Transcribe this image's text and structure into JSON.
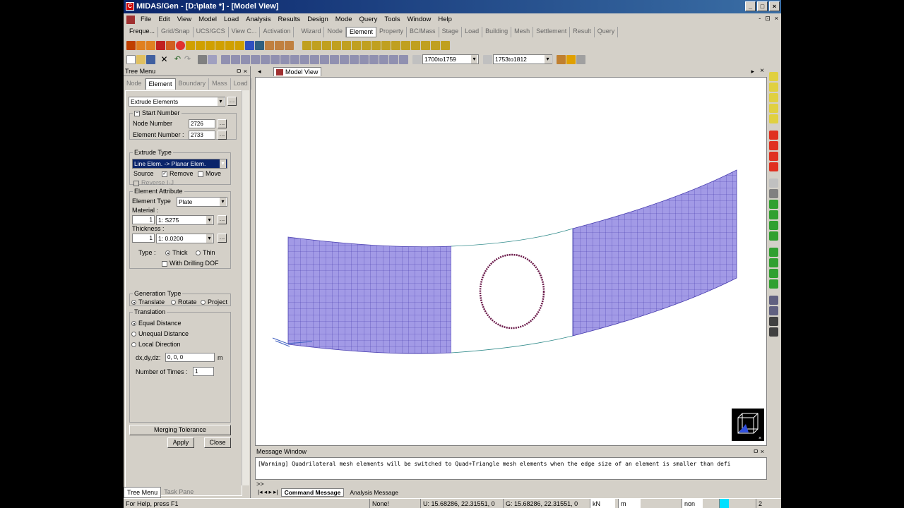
{
  "window": {
    "title": "MIDAS/Gen - [D:\\plate *] - [Model View]",
    "buttons": [
      "_",
      "□",
      "×"
    ]
  },
  "menu": {
    "items": [
      "File",
      "Edit",
      "View",
      "Model",
      "Load",
      "Analysis",
      "Results",
      "Design",
      "Mode",
      "Query",
      "Tools",
      "Window",
      "Help"
    ],
    "mdi_buttons": [
      "-",
      "⊡",
      "×"
    ]
  },
  "toolbar_tabs_left": [
    "Freque...",
    "Grid/Snap",
    "UCS/GCS",
    "View C...",
    "Activation"
  ],
  "toolbar_tabs_right": [
    "Wizard",
    "Node",
    "Element",
    "Property",
    "BC/Mass",
    "Stage",
    "Load",
    "Building",
    "Mesh",
    "Settlement",
    "Result",
    "Query"
  ],
  "toolbar_active_tab": "Element",
  "toolbar3": {
    "node_range": "1700to1759",
    "elem_range": "1753to1812"
  },
  "tree_menu": {
    "title": "Tree Menu",
    "tabs": [
      "Node",
      "Element",
      "Boundary",
      "Mass",
      "Load"
    ],
    "active_tab": "Element",
    "function": "Extrude Elements",
    "start_number_label": "Start Number",
    "node_number_label": "Node Number",
    "node_number_value": "2726",
    "element_number_label": "Element Number :",
    "element_number_value": "2733",
    "extrude_type_label": "Extrude Type",
    "extrude_type_value": "Line Elem. -> Planar Elem.",
    "source_label": "Source",
    "remove_label": "Remove",
    "move_label": "Move",
    "reverse_label": "Reverse I-J",
    "element_attribute_label": "Element Attribute",
    "element_type_label": "Element Type",
    "element_type_value": "Plate",
    "material_label": "Material :",
    "material_num": "1",
    "material_value": "1: S275",
    "thickness_label": "Thickness :",
    "thickness_num": "1",
    "thickness_value": "1: 0.0200",
    "type_label": "Type :",
    "thick_label": "Thick",
    "thin_label": "Thin",
    "drilling_label": "With Drilling DOF",
    "generation_type_label": "Generation Type",
    "translate_label": "Translate",
    "rotate_label": "Rotate",
    "project_label": "Project",
    "translation_label": "Translation",
    "equal_distance_label": "Equal Distance",
    "unequal_distance_label": "Unequal Distance",
    "local_direction_label": "Local Direction",
    "dxdydz_label": "dx,dy,dz:",
    "dxdydz_value": "0, 0, 0",
    "unit_m": "m",
    "times_label": "Number of Times :",
    "times_value": "1",
    "merging_tolerance": "Merging Tolerance",
    "apply": "Apply",
    "close": "Close",
    "bottom_tabs": [
      "Tree Menu",
      "Task Pane"
    ]
  },
  "model_view": {
    "tab_label": "Model View",
    "mesh_color": "#9b8fe0",
    "hole_color": "#6b1a4a"
  },
  "message_window": {
    "title": "Message Window",
    "text": "[Warning] Quadrilateral mesh elements will be switched to Quad+Triangle mesh elements when the edge size of an element is smaller than defi",
    "prompt": ">>",
    "tabs": [
      "Command Message",
      "Analysis Message"
    ]
  },
  "status": {
    "help": "For Help, press F1",
    "snap": "None!",
    "ucs": "U: 15.68286, 22.31551, 0",
    "gcs": "G: 15.68286, 22.31551, 0",
    "force_unit": "kN",
    "length_unit": "m",
    "mode": "non",
    "page": "2"
  }
}
